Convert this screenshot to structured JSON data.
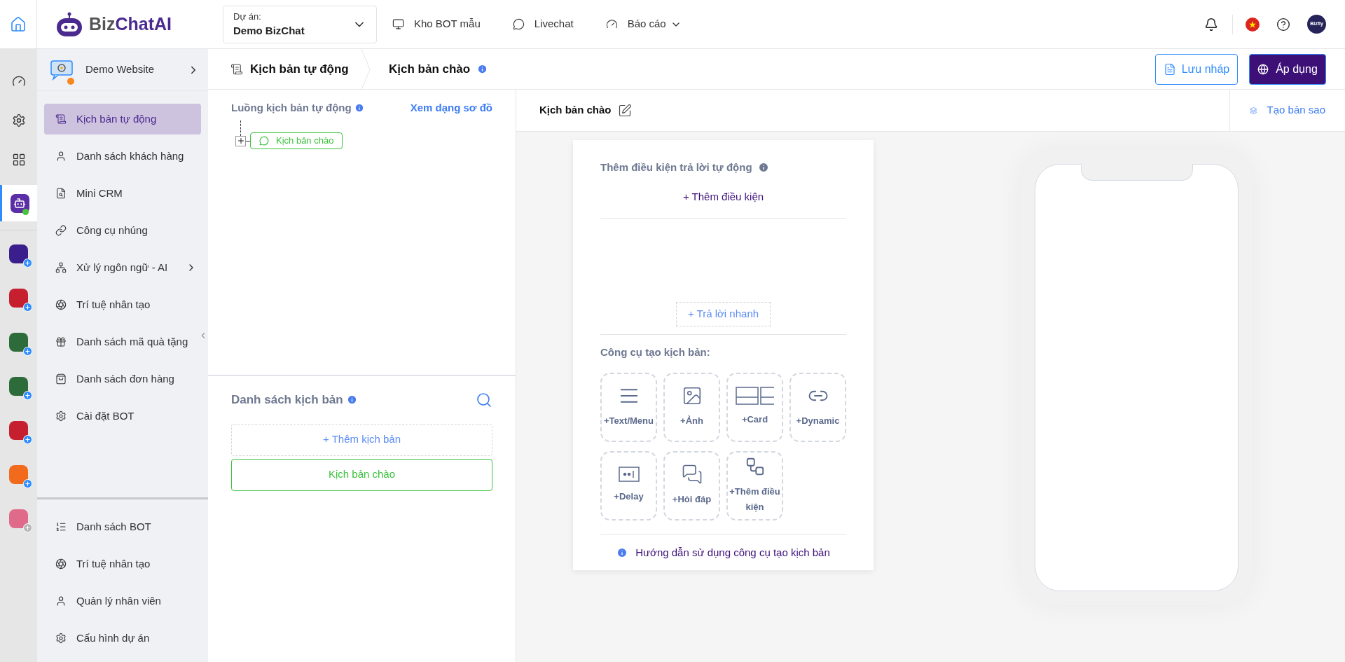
{
  "header": {
    "logo": {
      "part1": "Biz",
      "part2": "ChatAI"
    },
    "project": {
      "label": "Dự án:",
      "value": "Demo BizChat"
    },
    "nav": [
      {
        "label": "Kho BOT mẫu",
        "dropdown": false
      },
      {
        "label": "Livechat",
        "dropdown": false
      },
      {
        "label": "Báo cáo",
        "dropdown": true
      }
    ],
    "avatar": "Bizfly"
  },
  "rail": {
    "tools": [
      {
        "selected": false
      },
      {
        "selected": false
      },
      {
        "selected": false
      },
      {
        "selected": true,
        "online": true
      }
    ],
    "apps": [
      {
        "color": "#3a1f8c",
        "enabled": true
      },
      {
        "color": "#c62030",
        "enabled": true
      },
      {
        "color": "#2e6b3a",
        "enabled": true
      },
      {
        "color": "#2e6b3a",
        "enabled": true
      },
      {
        "color": "#c62030",
        "enabled": true
      },
      {
        "color": "#f26a1b",
        "enabled": true
      },
      {
        "color": "#e06a8a",
        "enabled": false
      }
    ]
  },
  "sidebar": {
    "project": "Demo Website",
    "items": [
      {
        "label": "Kịch bản tự động",
        "selected": true,
        "submenu": false
      },
      {
        "label": "Danh sách khách hàng",
        "selected": false,
        "submenu": false
      },
      {
        "label": "Mini CRM",
        "selected": false,
        "submenu": false
      },
      {
        "label": "Công cụ nhúng",
        "selected": false,
        "submenu": false
      },
      {
        "label": "Xử lý ngôn ngữ - AI",
        "selected": false,
        "submenu": true
      },
      {
        "label": "Trí tuệ nhân tạo",
        "selected": false,
        "submenu": false
      },
      {
        "label": "Danh sách mã quà tặng",
        "selected": false,
        "submenu": false
      },
      {
        "label": "Danh sách đơn hàng",
        "selected": false,
        "submenu": false
      },
      {
        "label": "Cài đặt BOT",
        "selected": false,
        "submenu": false
      }
    ],
    "bottom_items": [
      {
        "label": "Danh sách BOT",
        "selected": false
      },
      {
        "label": "Trí tuệ nhân tạo",
        "selected": false
      },
      {
        "label": "Quản lý nhân viên",
        "selected": false
      },
      {
        "label": "Cấu hình dự án",
        "selected": false
      }
    ]
  },
  "breadcrumb": [
    "Kịch bản tự động",
    "Kịch bản chào"
  ],
  "actions": {
    "save_draft": "Lưu nháp",
    "apply": "Áp dụng"
  },
  "flow": {
    "title": "Luồng kịch bản tự động",
    "link": "Xem dạng sơ đồ",
    "node": "Kịch bản chào"
  },
  "scripts": {
    "title": "Danh sách kịch bản",
    "add": "+ Thêm kịch bản",
    "items": [
      {
        "label": "Kịch bản chào",
        "selected": true
      }
    ]
  },
  "editor": {
    "title": "Kịch bản chào",
    "clone": "Tạo bản sao",
    "conditions_title": "Thêm điều kiện trả lời tự động",
    "add_condition": "+ Thêm điều kiện",
    "quick_reply": "+ Trả lời nhanh",
    "tools_title": "Công cụ tạo kịch bản:",
    "tools": [
      {
        "label": "+Text/Menu"
      },
      {
        "label": "+Ảnh"
      },
      {
        "label": "+Card"
      },
      {
        "label": "+Dynamic"
      },
      {
        "label": "+Delay"
      },
      {
        "label": "+Hỏi đáp"
      },
      {
        "label": "+Thêm điều kiện"
      }
    ],
    "guide": "Hướng dẫn sử dụng công cụ tạo kịch bản"
  }
}
